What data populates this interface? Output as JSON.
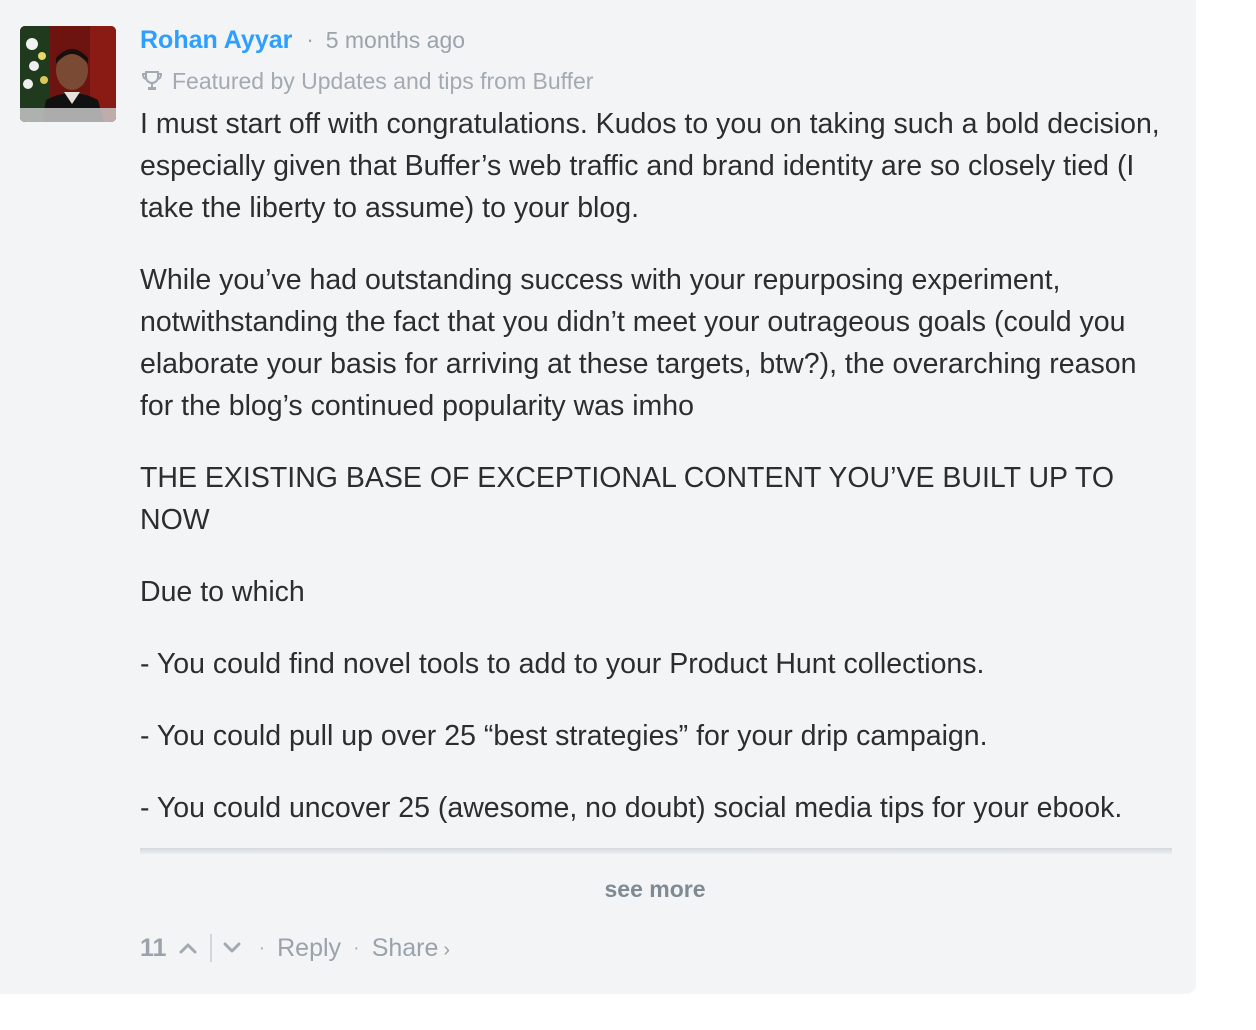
{
  "comment": {
    "author": "Rohan Ayyar",
    "timestamp": "5 months ago",
    "separator": "·",
    "featured_text": "Featured by Updates and tips from Buffer",
    "paragraphs": [
      "I must start off with congratulations. Kudos to you on taking such a bold decision, especially given that Buffer’s web traffic and brand identity are so closely tied (I take the liberty to assume) to your blog.",
      "While you’ve had outstanding success with your repurposing experiment, notwithstanding the fact that you didn’t meet your outrageous goals (could you elaborate your basis for arriving at these targets, btw?), the overarching reason for the blog’s continued popularity was imho",
      "THE EXISTING BASE OF EXCEPTIONAL CONTENT YOU’VE BUILT UP TO NOW",
      "Due to which",
      "- You could find novel tools to add to your Product Hunt collections.",
      "- You could pull up over 25 “best strategies” for your drip campaign.",
      "- You could uncover 25 (awesome, no doubt) social media tips for your ebook."
    ],
    "see_more_label": "see more",
    "votes": "11",
    "reply_label": "Reply",
    "share_label": "Share",
    "share_chevron": "›",
    "icons": {
      "featured": "trophy-icon",
      "upvote": "chevron-up-icon",
      "downvote": "chevron-down-icon"
    }
  },
  "colors": {
    "author_link": "#2e9fff",
    "meta_text": "#9aa3ab",
    "body_text": "#2a2e2e",
    "card_background": "#f3f4f6"
  }
}
